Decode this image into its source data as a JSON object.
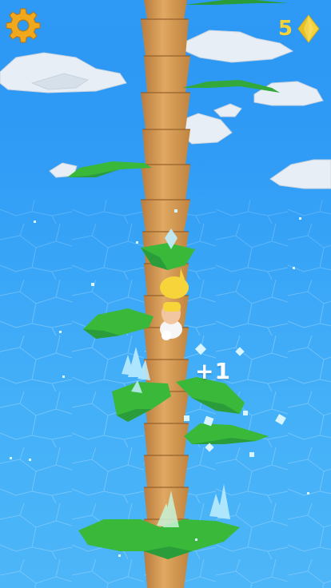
{
  "hud": {
    "settings_icon": "gear-icon",
    "gem_count": "5",
    "gem_icon": "diamond-icon",
    "gem_color": "#f4d23a"
  },
  "popup": {
    "score_gain": "+1"
  },
  "colors": {
    "sky": "#2e9af5",
    "trunk": "#d9a05a",
    "leaf": "#3ab83a",
    "gear": "#f0a81c",
    "character_hat": "#f7d43a"
  }
}
